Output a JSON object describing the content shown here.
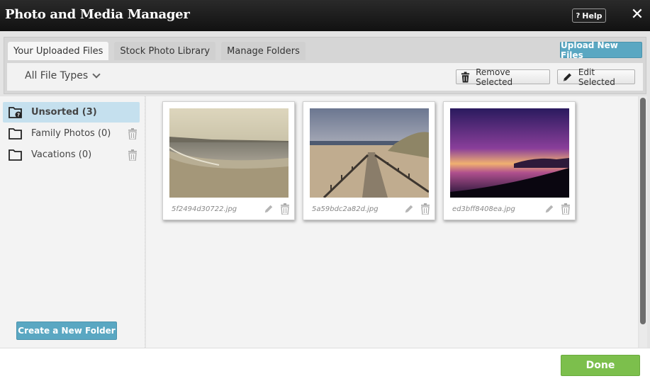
{
  "window": {
    "title": "Photo and Media Manager",
    "help_label": "Help",
    "help_icon": "?",
    "close_icon": "✕"
  },
  "tabs": [
    {
      "label": "Your Uploaded Files",
      "active": true
    },
    {
      "label": "Stock Photo Library",
      "active": false
    },
    {
      "label": "Manage Folders",
      "active": false
    }
  ],
  "toolbar": {
    "upload_label": "Upload New Files",
    "filter_label": "All File Types",
    "remove_label": "Remove Selected",
    "edit_label": "Edit Selected"
  },
  "folders": [
    {
      "name": "Unsorted",
      "count": "(3)",
      "active": true
    },
    {
      "name": "Family Photos",
      "count": "(0)",
      "active": false
    },
    {
      "name": "Vacations",
      "count": "(0)",
      "active": false
    }
  ],
  "create_folder_label": "Create a New Folder",
  "files": [
    {
      "name": "5f2494d30722.jpg"
    },
    {
      "name": "5a59bdc2a82d.jpg"
    },
    {
      "name": "ed3bff8408ea.jpg"
    }
  ],
  "footer": {
    "done_label": "Done"
  },
  "colors": {
    "accent_blue": "#5aa7c2",
    "done_green": "#7cbf4c",
    "active_folder": "#c5e0ee"
  }
}
